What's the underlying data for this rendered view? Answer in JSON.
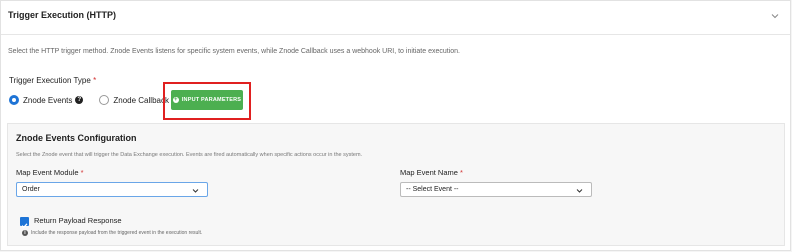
{
  "section": {
    "title": "Trigger Execution (HTTP)",
    "description": "Select the HTTP trigger method. Znode Events listens for specific system events, while Znode Callback uses a webhook URI, to initiate execution."
  },
  "trigger_type": {
    "label": "Trigger Execution Type",
    "required_mark": "*",
    "options": [
      {
        "label": "Znode Events",
        "selected": true
      },
      {
        "label": "Znode Callback",
        "selected": false
      }
    ],
    "help_icon": "?"
  },
  "input_parameters_button": {
    "label": "INPUT PARAMETERS",
    "icon": "+"
  },
  "config": {
    "title": "Znode Events Configuration",
    "description": "Select the Znode event that will trigger the Data Exchange execution. Events are fired automatically when specific actions occur in the system.",
    "module": {
      "label": "Map Event Module",
      "required_mark": "*",
      "value": "Order"
    },
    "event_name": {
      "label": "Map Event Name",
      "required_mark": "*",
      "value": "-- Select Event --"
    },
    "return_payload": {
      "label": "Return Payload Response",
      "checked": true,
      "hint": "Include the response payload from the triggered event in the execution result.",
      "info_icon": "i"
    }
  },
  "colors": {
    "accent": "#1e74d6",
    "button": "#4caf50",
    "highlight": "#e02020",
    "required": "#d32f2f"
  }
}
